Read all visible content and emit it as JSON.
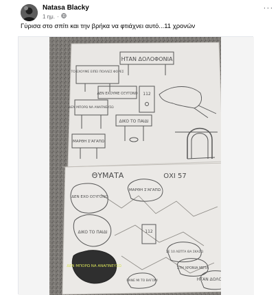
{
  "post": {
    "author": "Natasa Blacky",
    "time": "1 ημ.",
    "visibility_icon": "globe-icon",
    "more_icon": "more-icon",
    "caption": "Γύρισα στο σπίτι και την βρήκα να φτιάχνει αυτό...11 χρονών"
  },
  "drawing": {
    "top_sheet": {
      "title": "ΗΤΑΝ ΔΟΛΟΦΟΝΙΑ",
      "sign_1": "ΤΟ ΕΧΟΥΜΕ ΕΙΠΕΙ ΠΟΛΛΕΣ ΦΟΡΕΣ",
      "sign_2": "ΔΕΝ ΕΧΟΥΜΕ ΟΞΥΓΟΝΟ",
      "sign_3": "ΔΕΝ ΜΠΟΡΩ ΝΑ ΑΝΑΠΝΕΥΣΩ",
      "phone_label": "112",
      "sign_4": "ΔΙΚΟ ΤΟ ΠΑΙΔΙ",
      "sign_5": "ΜΑΡΘΗ Σ'ΑΓΑΠΩ"
    },
    "bottom_sheet": {
      "title": "ΘΥΜΑΤΑ",
      "title_2": "ΟΧΙ 57",
      "bubble_1": "ΔΕΝ ΕΧΟ ΟΞΥΓΟΝΟ",
      "bubble_2": "ΜΑΡΘΗ Σ'ΑΓΑΠΩ",
      "bubble_3": "ΔΙΚΟ ΤΟ ΠΑΙΔΙ",
      "bubble_4": "112",
      "bubble_5": "ΔΕΝ ΜΠΟΡΩ ΝΑ ΑΝΑΠΝΕΥΣΩ",
      "bubble_6": "ΣΕ 10 ΛΕΠΤΑ ΘΑ ΣΚΑΣΩ",
      "bubble_7": "ΣΤΗ ΧΡΟΝΙΑ ΜΕΤΑ",
      "bubble_8": "ΗΤΑΝ ΔΟΛΟΦΟΝΙΑ",
      "bubble_9": "ΠΑΝΕ ΜΙ ΤΟ ΒΑΓΟΝΙ"
    }
  }
}
